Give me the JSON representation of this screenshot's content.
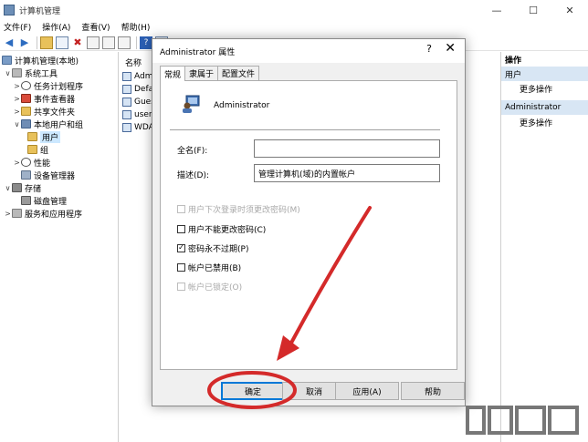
{
  "window": {
    "title": "计算机管理",
    "controls": [
      "—",
      "☐",
      "✕"
    ]
  },
  "menu": [
    "文件(F)",
    "操作(A)",
    "查看(V)",
    "帮助(H)"
  ],
  "tree": {
    "root": "计算机管理(本地)",
    "system_tools": "系统工具",
    "task_scheduler": "任务计划程序",
    "event_viewer": "事件查看器",
    "shared_folders": "共享文件夹",
    "local_users_groups": "本地用户和组",
    "users": "用户",
    "groups": "组",
    "performance": "性能",
    "device_manager": "设备管理器",
    "storage": "存储",
    "disk_management": "磁盘管理",
    "services_apps": "服务和应用程序"
  },
  "list": {
    "column_name": "名称",
    "items": [
      "Admi",
      "Defa",
      "Gues",
      "user",
      "WDA"
    ]
  },
  "actions": {
    "header": "操作",
    "section1": "用户",
    "more1": "更多操作",
    "section2": "Administrator",
    "more2": "更多操作"
  },
  "dialog": {
    "title": "Administrator 属性",
    "help_glyph": "?",
    "close_glyph": "✕",
    "tabs": [
      "常规",
      "隶属于",
      "配置文件"
    ],
    "username": "Administrator",
    "fullname_label": "全名(F):",
    "fullname_value": "",
    "description_label": "描述(D):",
    "description_value": "管理计算机(域)的内置帐户",
    "options": [
      {
        "label": "用户下次登录时须更改密码(M)",
        "checked": false,
        "disabled": true
      },
      {
        "label": "用户不能更改密码(C)",
        "checked": false,
        "disabled": false
      },
      {
        "label": "密码永不过期(P)",
        "checked": true,
        "disabled": false
      },
      {
        "label": "帐户已禁用(B)",
        "checked": false,
        "disabled": false
      },
      {
        "label": "帐户已锁定(O)",
        "checked": false,
        "disabled": true
      }
    ],
    "buttons": {
      "ok": "确定",
      "cancel": "取消",
      "apply": "应用(A)",
      "help": "帮助"
    }
  },
  "colors": {
    "selection": "#cce8ff",
    "accent": "#0078d7",
    "annotation_red": "#d42a2a"
  }
}
